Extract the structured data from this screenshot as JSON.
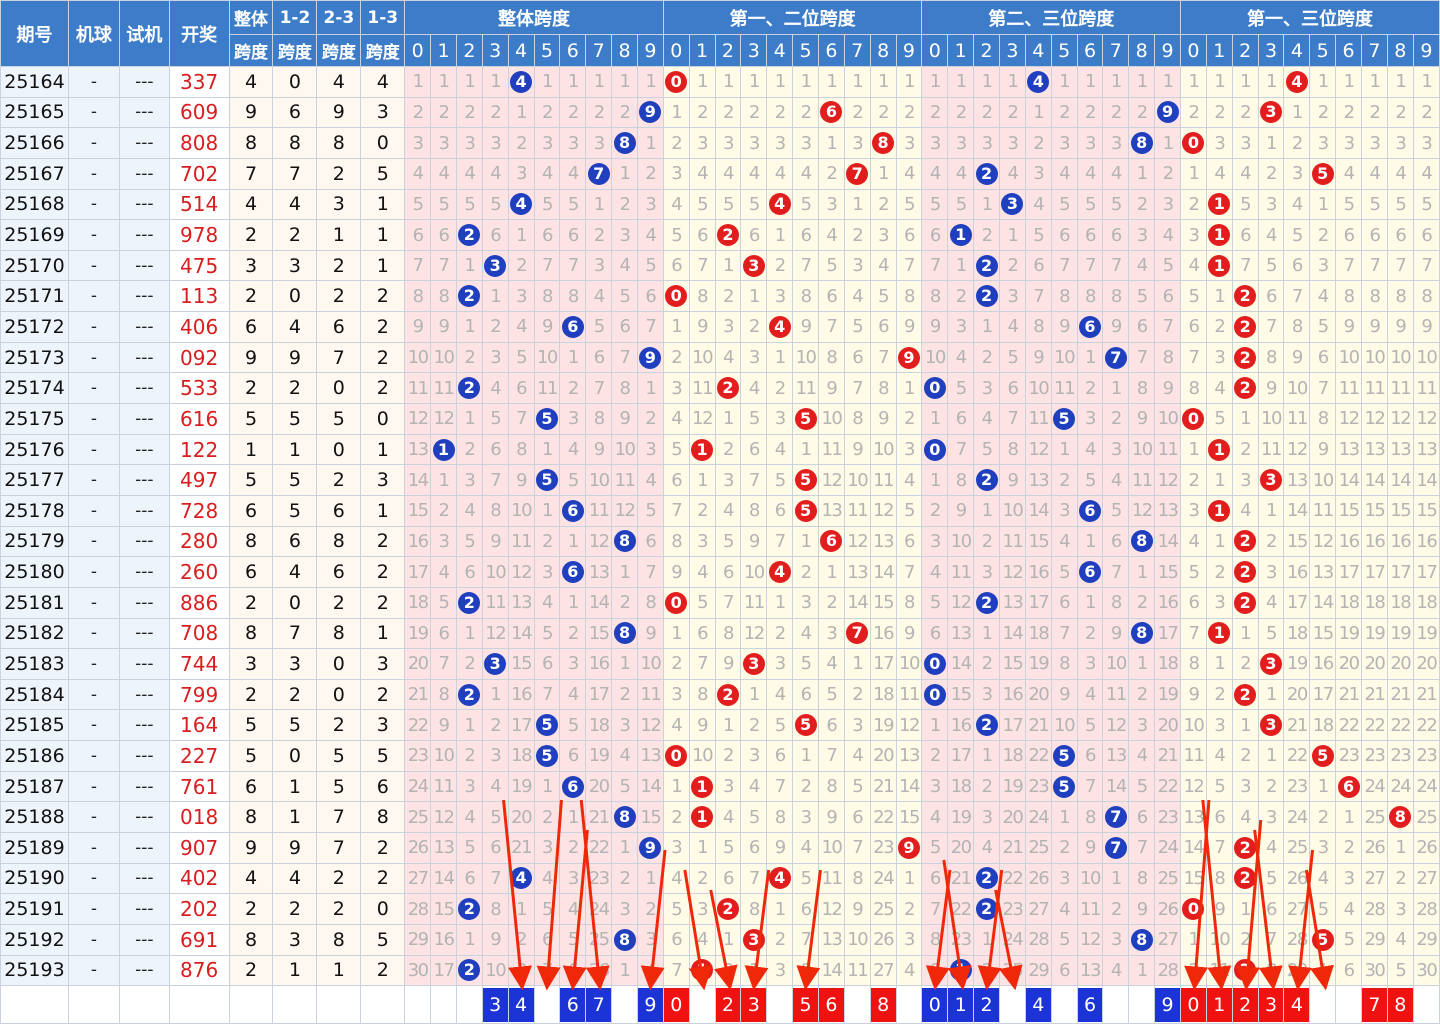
{
  "chart_data": {
    "type": "table",
    "columns": {
      "issue": "期号",
      "machine": "机球",
      "trial": "试机",
      "draw": "开奖",
      "span_total_1": "整体",
      "span_total_2": "跨度",
      "span_12_1": "1-2",
      "span_12_2": "跨度",
      "span_23_1": "2-3",
      "span_23_2": "跨度",
      "span_13_1": "1-3",
      "span_13_2": "跨度"
    },
    "groups": [
      "整体跨度",
      "第一、二位跨度",
      "第二、三位跨度",
      "第一、三位跨度"
    ],
    "digits": [
      "0",
      "1",
      "2",
      "3",
      "4",
      "5",
      "6",
      "7",
      "8",
      "9"
    ],
    "rows": [
      {
        "issue": "25164",
        "machine": "-",
        "trial": "---",
        "draw": "337",
        "spans": [
          4,
          0,
          4,
          4
        ]
      },
      {
        "issue": "25165",
        "machine": "-",
        "trial": "---",
        "draw": "609",
        "spans": [
          9,
          6,
          9,
          3
        ]
      },
      {
        "issue": "25166",
        "machine": "-",
        "trial": "---",
        "draw": "808",
        "spans": [
          8,
          8,
          8,
          0
        ]
      },
      {
        "issue": "25167",
        "machine": "-",
        "trial": "---",
        "draw": "702",
        "spans": [
          7,
          7,
          2,
          5
        ]
      },
      {
        "issue": "25168",
        "machine": "-",
        "trial": "---",
        "draw": "514",
        "spans": [
          4,
          4,
          3,
          1
        ]
      },
      {
        "issue": "25169",
        "machine": "-",
        "trial": "---",
        "draw": "978",
        "spans": [
          2,
          2,
          1,
          1
        ]
      },
      {
        "issue": "25170",
        "machine": "-",
        "trial": "---",
        "draw": "475",
        "spans": [
          3,
          3,
          2,
          1
        ]
      },
      {
        "issue": "25171",
        "machine": "-",
        "trial": "---",
        "draw": "113",
        "spans": [
          2,
          0,
          2,
          2
        ]
      },
      {
        "issue": "25172",
        "machine": "-",
        "trial": "---",
        "draw": "406",
        "spans": [
          6,
          4,
          6,
          2
        ]
      },
      {
        "issue": "25173",
        "machine": "-",
        "trial": "---",
        "draw": "092",
        "spans": [
          9,
          9,
          7,
          2
        ]
      },
      {
        "issue": "25174",
        "machine": "-",
        "trial": "---",
        "draw": "533",
        "spans": [
          2,
          2,
          0,
          2
        ]
      },
      {
        "issue": "25175",
        "machine": "-",
        "trial": "---",
        "draw": "616",
        "spans": [
          5,
          5,
          5,
          0
        ]
      },
      {
        "issue": "25176",
        "machine": "-",
        "trial": "---",
        "draw": "122",
        "spans": [
          1,
          1,
          0,
          1
        ]
      },
      {
        "issue": "25177",
        "machine": "-",
        "trial": "---",
        "draw": "497",
        "spans": [
          5,
          5,
          2,
          3
        ]
      },
      {
        "issue": "25178",
        "machine": "-",
        "trial": "---",
        "draw": "728",
        "spans": [
          6,
          5,
          6,
          1
        ]
      },
      {
        "issue": "25179",
        "machine": "-",
        "trial": "---",
        "draw": "280",
        "spans": [
          8,
          6,
          8,
          2
        ]
      },
      {
        "issue": "25180",
        "machine": "-",
        "trial": "---",
        "draw": "260",
        "spans": [
          6,
          4,
          6,
          2
        ]
      },
      {
        "issue": "25181",
        "machine": "-",
        "trial": "---",
        "draw": "886",
        "spans": [
          2,
          0,
          2,
          2
        ]
      },
      {
        "issue": "25182",
        "machine": "-",
        "trial": "---",
        "draw": "708",
        "spans": [
          8,
          7,
          8,
          1
        ]
      },
      {
        "issue": "25183",
        "machine": "-",
        "trial": "---",
        "draw": "744",
        "spans": [
          3,
          3,
          0,
          3
        ]
      },
      {
        "issue": "25184",
        "machine": "-",
        "trial": "---",
        "draw": "799",
        "spans": [
          2,
          2,
          0,
          2
        ]
      },
      {
        "issue": "25185",
        "machine": "-",
        "trial": "---",
        "draw": "164",
        "spans": [
          5,
          5,
          2,
          3
        ]
      },
      {
        "issue": "25186",
        "machine": "-",
        "trial": "---",
        "draw": "227",
        "spans": [
          5,
          0,
          5,
          5
        ]
      },
      {
        "issue": "25187",
        "machine": "-",
        "trial": "---",
        "draw": "761",
        "spans": [
          6,
          1,
          5,
          6
        ]
      },
      {
        "issue": "25188",
        "machine": "-",
        "trial": "---",
        "draw": "018",
        "spans": [
          8,
          1,
          7,
          8
        ]
      },
      {
        "issue": "25189",
        "machine": "-",
        "trial": "---",
        "draw": "907",
        "spans": [
          9,
          9,
          7,
          2
        ]
      },
      {
        "issue": "25190",
        "machine": "-",
        "trial": "---",
        "draw": "402",
        "spans": [
          4,
          4,
          2,
          2
        ]
      },
      {
        "issue": "25191",
        "machine": "-",
        "trial": "---",
        "draw": "202",
        "spans": [
          2,
          2,
          2,
          0
        ]
      },
      {
        "issue": "25192",
        "machine": "-",
        "trial": "---",
        "draw": "691",
        "spans": [
          8,
          3,
          8,
          5
        ]
      },
      {
        "issue": "25193",
        "machine": "-",
        "trial": "---",
        "draw": "876",
        "spans": [
          2,
          1,
          1,
          2
        ]
      }
    ],
    "first_row_miss": [
      [
        1,
        1,
        1,
        1,
        0,
        1,
        1,
        1,
        1,
        1
      ],
      [
        0,
        1,
        1,
        1,
        1,
        1,
        1,
        1,
        1,
        1
      ],
      [
        1,
        1,
        1,
        1,
        0,
        1,
        1,
        1,
        1,
        1
      ],
      [
        1,
        1,
        1,
        1,
        0,
        1,
        1,
        1,
        1,
        1
      ]
    ],
    "prediction": [
      {
        "blue": [
          "3",
          "4",
          "6",
          "7",
          "9"
        ]
      },
      {
        "red": [
          "0",
          "2",
          "3",
          "5",
          "6",
          "8"
        ]
      },
      {
        "blue": [
          "0",
          "1",
          "2",
          "4",
          "6",
          "9"
        ]
      },
      {
        "red": [
          "0",
          "1",
          "2",
          "3",
          "4",
          "7",
          "8"
        ]
      }
    ],
    "annotation": "red arrows from the lower cells pointing down to the prediction row"
  },
  "colors": {
    "header_blue": "#3d7cc9",
    "blue_ball": "#1f3fbf",
    "red_ball": "#e21d1d",
    "zone_pink": "#fde3e3",
    "zone_yellow": "#fffbe6",
    "arrow_red": "#f0280a"
  }
}
